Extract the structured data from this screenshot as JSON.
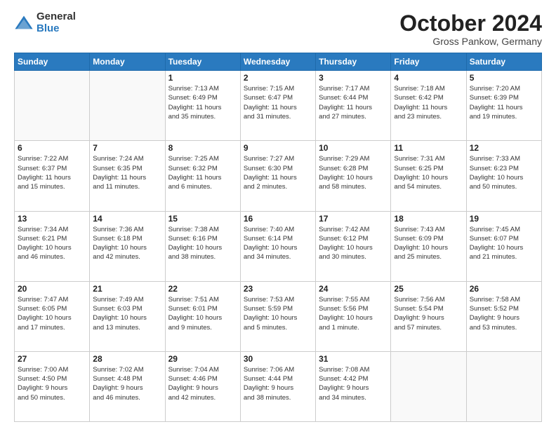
{
  "logo": {
    "general": "General",
    "blue": "Blue"
  },
  "header": {
    "month": "October 2024",
    "location": "Gross Pankow, Germany"
  },
  "weekdays": [
    "Sunday",
    "Monday",
    "Tuesday",
    "Wednesday",
    "Thursday",
    "Friday",
    "Saturday"
  ],
  "weeks": [
    [
      {
        "day": "",
        "info": ""
      },
      {
        "day": "",
        "info": ""
      },
      {
        "day": "1",
        "info": "Sunrise: 7:13 AM\nSunset: 6:49 PM\nDaylight: 11 hours\nand 35 minutes."
      },
      {
        "day": "2",
        "info": "Sunrise: 7:15 AM\nSunset: 6:47 PM\nDaylight: 11 hours\nand 31 minutes."
      },
      {
        "day": "3",
        "info": "Sunrise: 7:17 AM\nSunset: 6:44 PM\nDaylight: 11 hours\nand 27 minutes."
      },
      {
        "day": "4",
        "info": "Sunrise: 7:18 AM\nSunset: 6:42 PM\nDaylight: 11 hours\nand 23 minutes."
      },
      {
        "day": "5",
        "info": "Sunrise: 7:20 AM\nSunset: 6:39 PM\nDaylight: 11 hours\nand 19 minutes."
      }
    ],
    [
      {
        "day": "6",
        "info": "Sunrise: 7:22 AM\nSunset: 6:37 PM\nDaylight: 11 hours\nand 15 minutes."
      },
      {
        "day": "7",
        "info": "Sunrise: 7:24 AM\nSunset: 6:35 PM\nDaylight: 11 hours\nand 11 minutes."
      },
      {
        "day": "8",
        "info": "Sunrise: 7:25 AM\nSunset: 6:32 PM\nDaylight: 11 hours\nand 6 minutes."
      },
      {
        "day": "9",
        "info": "Sunrise: 7:27 AM\nSunset: 6:30 PM\nDaylight: 11 hours\nand 2 minutes."
      },
      {
        "day": "10",
        "info": "Sunrise: 7:29 AM\nSunset: 6:28 PM\nDaylight: 10 hours\nand 58 minutes."
      },
      {
        "day": "11",
        "info": "Sunrise: 7:31 AM\nSunset: 6:25 PM\nDaylight: 10 hours\nand 54 minutes."
      },
      {
        "day": "12",
        "info": "Sunrise: 7:33 AM\nSunset: 6:23 PM\nDaylight: 10 hours\nand 50 minutes."
      }
    ],
    [
      {
        "day": "13",
        "info": "Sunrise: 7:34 AM\nSunset: 6:21 PM\nDaylight: 10 hours\nand 46 minutes."
      },
      {
        "day": "14",
        "info": "Sunrise: 7:36 AM\nSunset: 6:18 PM\nDaylight: 10 hours\nand 42 minutes."
      },
      {
        "day": "15",
        "info": "Sunrise: 7:38 AM\nSunset: 6:16 PM\nDaylight: 10 hours\nand 38 minutes."
      },
      {
        "day": "16",
        "info": "Sunrise: 7:40 AM\nSunset: 6:14 PM\nDaylight: 10 hours\nand 34 minutes."
      },
      {
        "day": "17",
        "info": "Sunrise: 7:42 AM\nSunset: 6:12 PM\nDaylight: 10 hours\nand 30 minutes."
      },
      {
        "day": "18",
        "info": "Sunrise: 7:43 AM\nSunset: 6:09 PM\nDaylight: 10 hours\nand 25 minutes."
      },
      {
        "day": "19",
        "info": "Sunrise: 7:45 AM\nSunset: 6:07 PM\nDaylight: 10 hours\nand 21 minutes."
      }
    ],
    [
      {
        "day": "20",
        "info": "Sunrise: 7:47 AM\nSunset: 6:05 PM\nDaylight: 10 hours\nand 17 minutes."
      },
      {
        "day": "21",
        "info": "Sunrise: 7:49 AM\nSunset: 6:03 PM\nDaylight: 10 hours\nand 13 minutes."
      },
      {
        "day": "22",
        "info": "Sunrise: 7:51 AM\nSunset: 6:01 PM\nDaylight: 10 hours\nand 9 minutes."
      },
      {
        "day": "23",
        "info": "Sunrise: 7:53 AM\nSunset: 5:59 PM\nDaylight: 10 hours\nand 5 minutes."
      },
      {
        "day": "24",
        "info": "Sunrise: 7:55 AM\nSunset: 5:56 PM\nDaylight: 10 hours\nand 1 minute."
      },
      {
        "day": "25",
        "info": "Sunrise: 7:56 AM\nSunset: 5:54 PM\nDaylight: 9 hours\nand 57 minutes."
      },
      {
        "day": "26",
        "info": "Sunrise: 7:58 AM\nSunset: 5:52 PM\nDaylight: 9 hours\nand 53 minutes."
      }
    ],
    [
      {
        "day": "27",
        "info": "Sunrise: 7:00 AM\nSunset: 4:50 PM\nDaylight: 9 hours\nand 50 minutes."
      },
      {
        "day": "28",
        "info": "Sunrise: 7:02 AM\nSunset: 4:48 PM\nDaylight: 9 hours\nand 46 minutes."
      },
      {
        "day": "29",
        "info": "Sunrise: 7:04 AM\nSunset: 4:46 PM\nDaylight: 9 hours\nand 42 minutes."
      },
      {
        "day": "30",
        "info": "Sunrise: 7:06 AM\nSunset: 4:44 PM\nDaylight: 9 hours\nand 38 minutes."
      },
      {
        "day": "31",
        "info": "Sunrise: 7:08 AM\nSunset: 4:42 PM\nDaylight: 9 hours\nand 34 minutes."
      },
      {
        "day": "",
        "info": ""
      },
      {
        "day": "",
        "info": ""
      }
    ]
  ]
}
